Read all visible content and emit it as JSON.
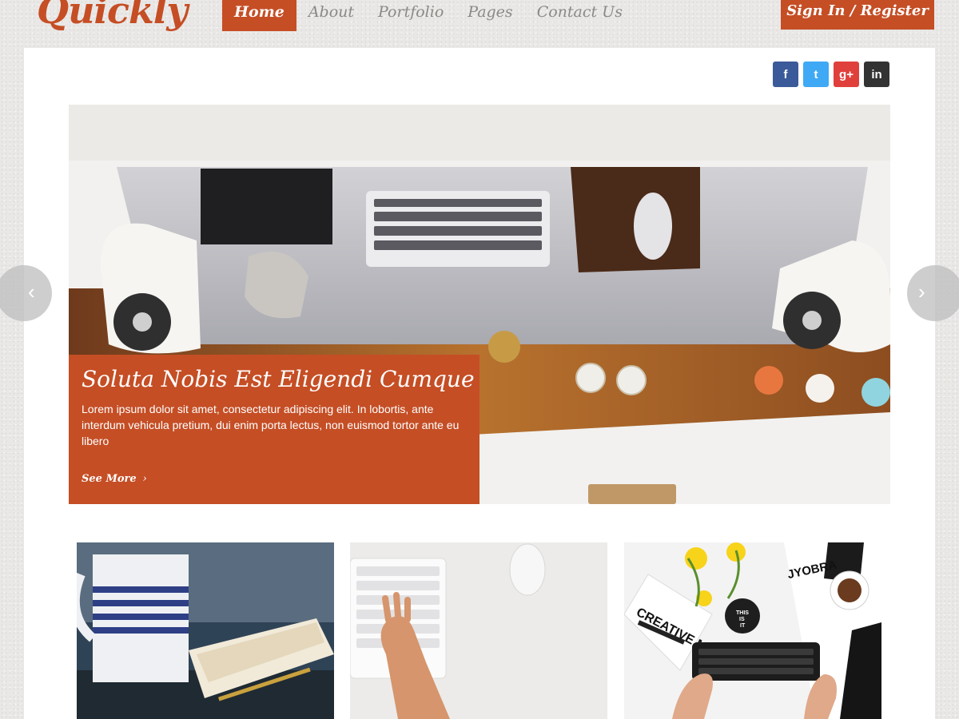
{
  "header": {
    "logo": "Quickly",
    "nav": [
      "Home",
      "About",
      "Portfolio",
      "Pages",
      "Contact Us"
    ],
    "sign_in": "Sign In / Register"
  },
  "social": {
    "facebook": "f",
    "twitter": "t",
    "google_plus": "g+",
    "linkedin": "in"
  },
  "slider": {
    "title": "Soluta Nobis Est Eligendi Cumque",
    "text": "Lorem ipsum dolor sit amet, consectetur adipiscing elit. In lobortis, ante interdum vehicula pretium, dui enim porta lectus, non euismod tortor ante eu libero",
    "see_more": "See More",
    "prev_icon": "chevron-left-icon",
    "next_icon": "chevron-right-icon"
  },
  "thumbs": {
    "three_text_lines": [
      "THIS",
      "IS",
      "IT"
    ],
    "creative_mess": "CREATIVE MESS",
    "joybra": "JYOBRA"
  },
  "colors": {
    "accent": "#c54e25",
    "facebook": "#3b5a9a",
    "twitter": "#3fa9f5",
    "google_plus": "#e0403b",
    "linkedin": "#333333"
  }
}
